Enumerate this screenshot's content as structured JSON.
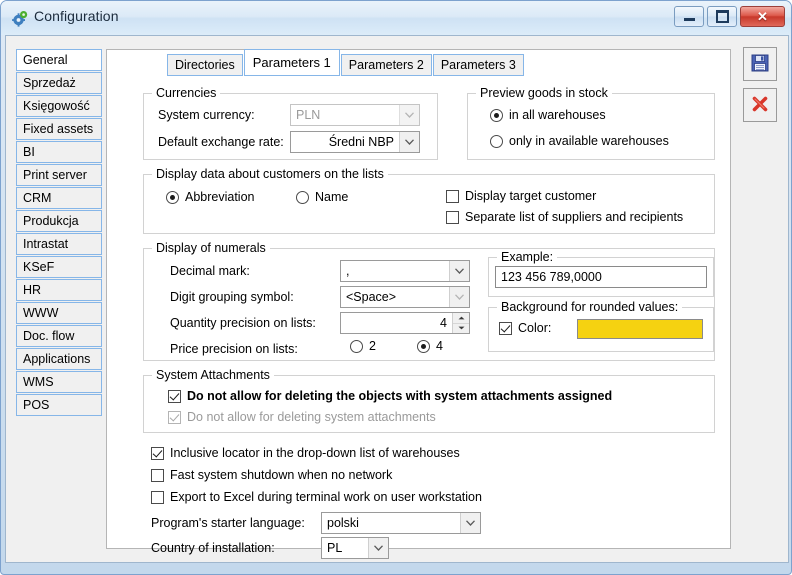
{
  "window": {
    "title": "Configuration",
    "icon": "gear-icon",
    "buttons": {
      "minimize": "minimize-icon",
      "restore": "restore-icon",
      "close": "✕"
    }
  },
  "toolbar": {
    "save_label": "save-icon",
    "cancel_label": "cancel-icon"
  },
  "sidebar": {
    "items": [
      {
        "label": "General",
        "selected": true
      },
      {
        "label": "Sprzedaż",
        "selected": false
      },
      {
        "label": "Księgowość",
        "selected": false
      },
      {
        "label": "Fixed assets",
        "selected": false
      },
      {
        "label": "BI",
        "selected": false
      },
      {
        "label": "Print server",
        "selected": false
      },
      {
        "label": "CRM",
        "selected": false
      },
      {
        "label": "Produkcja",
        "selected": false
      },
      {
        "label": "Intrastat",
        "selected": false
      },
      {
        "label": "KSeF",
        "selected": false
      },
      {
        "label": "HR",
        "selected": false
      },
      {
        "label": "WWW",
        "selected": false
      },
      {
        "label": "Doc. flow",
        "selected": false
      },
      {
        "label": "Applications",
        "selected": false
      },
      {
        "label": "WMS",
        "selected": false
      },
      {
        "label": "POS",
        "selected": false
      }
    ]
  },
  "tabs": [
    {
      "label": "Directories",
      "active": false
    },
    {
      "label": "Parameters 1",
      "active": true
    },
    {
      "label": "Parameters 2",
      "active": false
    },
    {
      "label": "Parameters 3",
      "active": false
    }
  ],
  "currencies": {
    "legend": "Currencies",
    "system_currency_label": "System currency:",
    "system_currency_value": "PLN",
    "default_rate_label": "Default exchange rate:",
    "default_rate_value": "Średni NBP"
  },
  "preview_stock": {
    "legend": "Preview goods in stock",
    "option_all": "in all warehouses",
    "option_available": "only in available warehouses",
    "selected": "in all warehouses"
  },
  "customers_display": {
    "legend": "Display data about customers on the lists",
    "option_abbreviation": "Abbreviation",
    "option_name": "Name",
    "selected": "Abbreviation",
    "check_target_customer": "Display target customer",
    "check_target_customer_checked": false,
    "check_separate_lists": "Separate list of suppliers and recipients",
    "check_separate_lists_checked": false
  },
  "numerals": {
    "legend": "Display of numerals",
    "decimal_mark_label": "Decimal mark:",
    "decimal_mark_value": ",",
    "grouping_label": "Digit grouping symbol:",
    "grouping_value": "<Space>",
    "quantity_precision_label": "Quantity precision on lists:",
    "quantity_precision_value": "4",
    "price_precision_label": "Price precision on lists:",
    "price_precision_option_2": "2",
    "price_precision_option_4": "4",
    "price_precision_selected": "4"
  },
  "example": {
    "legend": "Example:",
    "value": "123 456 789,0000"
  },
  "rounded_background": {
    "legend": "Background for rounded values:",
    "color_label": "Color:",
    "color_checked": true,
    "color_value": "#F5D211"
  },
  "system_attachments": {
    "legend": "System Attachments",
    "check_objects": "Do not allow for deleting the objects with system attachments assigned",
    "check_objects_checked": true,
    "check_attachments": "Do not allow for deleting system attachments",
    "check_attachments_checked": true,
    "check_attachments_disabled": true
  },
  "standalone_checks": [
    {
      "label": "Inclusive locator in the drop-down list of warehouses",
      "checked": true
    },
    {
      "label": "Fast system shutdown when no network",
      "checked": false
    },
    {
      "label": "Export to Excel during terminal work on user workstation",
      "checked": false
    }
  ],
  "bottom": {
    "language_label": "Program's starter language:",
    "language_value": "polski",
    "country_label": "Country of installation:",
    "country_value": "PL"
  },
  "colors": {
    "accent_border": "#86b6e8",
    "swatch": "#F5D211",
    "close_button": "#c8392b"
  }
}
